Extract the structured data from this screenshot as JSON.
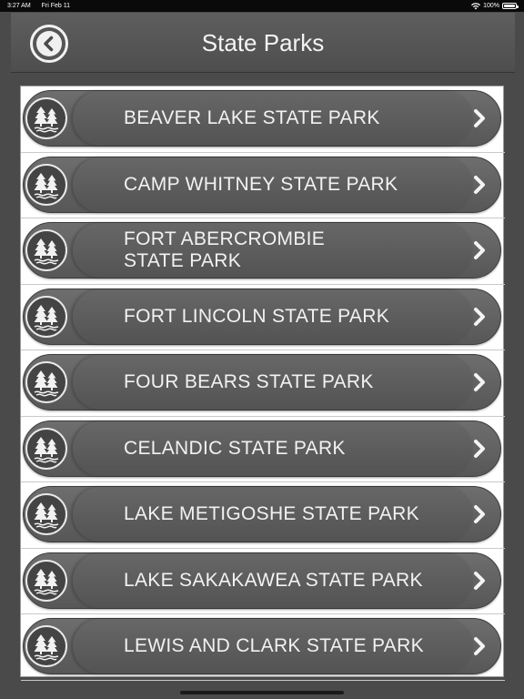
{
  "status_bar": {
    "time": "3:27 AM",
    "date": "Fri Feb 11",
    "battery": "100%",
    "battery_level": 1.0
  },
  "header": {
    "title": "State Parks",
    "back_icon": "chevron-left-circle-icon"
  },
  "parks": [
    {
      "name": "BEAVER LAKE STATE PARK",
      "icon": "pine-trees-water-icon"
    },
    {
      "name": "CAMP WHITNEY STATE PARK",
      "icon": "pine-trees-water-icon"
    },
    {
      "name": "FORT ABERCROMBIE\nSTATE PARK",
      "icon": "pine-trees-water-icon"
    },
    {
      "name": "FORT LINCOLN STATE PARK",
      "icon": "pine-trees-water-icon"
    },
    {
      "name": "FOUR BEARS STATE PARK",
      "icon": "pine-trees-water-icon"
    },
    {
      "name": "CELANDIC STATE PARK",
      "icon": "pine-trees-water-icon"
    },
    {
      "name": "LAKE METIGOSHE STATE PARK",
      "icon": "pine-trees-water-icon"
    },
    {
      "name": "LAKE SAKAKAWEA STATE PARK",
      "icon": "pine-trees-water-icon"
    },
    {
      "name": "LEWIS AND CLARK STATE PARK",
      "icon": "pine-trees-water-icon"
    }
  ],
  "colors": {
    "background": "#4a4a4a",
    "button": "#5f5f5f",
    "panel": "#ffffff",
    "text": "#f2f2f2"
  }
}
